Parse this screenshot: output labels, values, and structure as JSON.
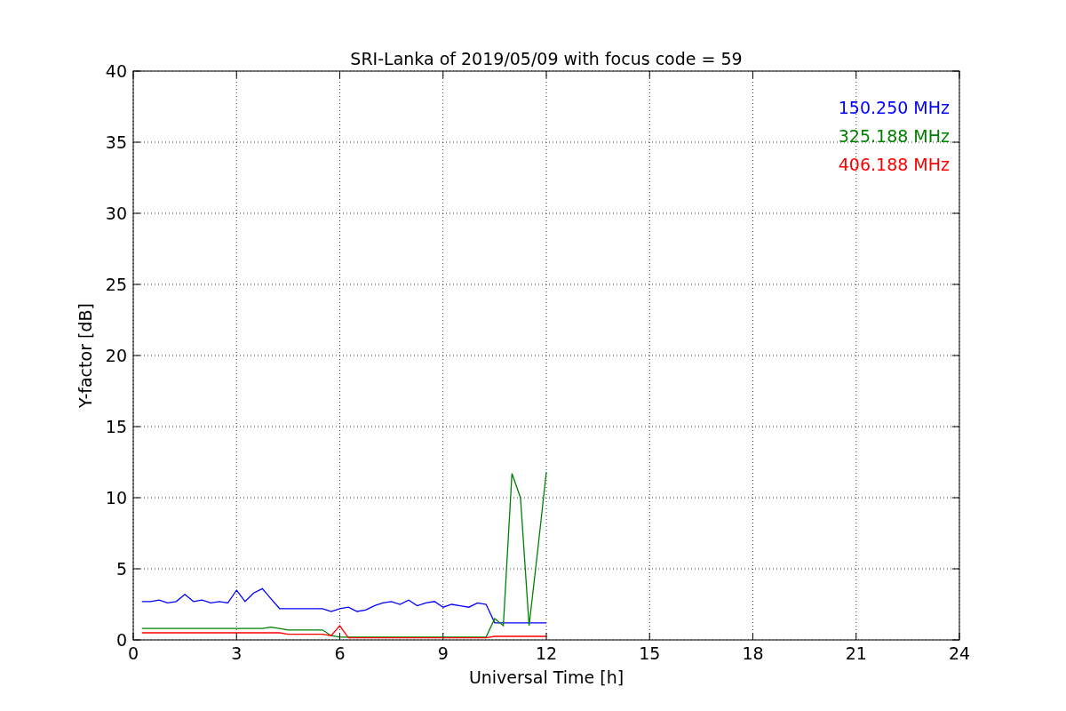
{
  "chart_data": {
    "type": "line",
    "title": "SRI-Lanka of 2019/05/09 with focus code = 59",
    "xlabel": "Universal Time [h]",
    "ylabel": "Y-factor [dB]",
    "xlim": [
      0,
      24
    ],
    "ylim": [
      0,
      40
    ],
    "grid": true,
    "xticks": [
      0,
      3,
      6,
      9,
      12,
      15,
      18,
      21,
      24
    ],
    "yticks": [
      0,
      5,
      10,
      15,
      20,
      25,
      30,
      35,
      40
    ],
    "x": [
      0.25,
      0.5,
      0.75,
      1,
      1.25,
      1.5,
      1.75,
      2,
      2.25,
      2.5,
      2.75,
      3,
      3.25,
      3.5,
      3.75,
      4,
      4.25,
      4.5,
      4.75,
      5,
      5.25,
      5.5,
      5.75,
      6,
      6.25,
      6.5,
      6.75,
      7,
      7.25,
      7.5,
      7.75,
      8,
      8.25,
      8.5,
      8.75,
      9,
      9.25,
      9.5,
      9.75,
      10,
      10.25,
      10.5,
      10.75,
      11,
      11.25,
      11.5,
      11.75,
      12
    ],
    "series": [
      {
        "name": "150.250 MHz",
        "color": "#0000ff",
        "values": [
          2.7,
          2.7,
          2.8,
          2.6,
          2.7,
          3.2,
          2.7,
          2.8,
          2.6,
          2.7,
          2.6,
          3.5,
          2.7,
          3.3,
          3.6,
          2.9,
          2.2,
          2.2,
          2.2,
          2.2,
          2.2,
          2.2,
          2.0,
          2.2,
          2.3,
          2.0,
          2.1,
          2.4,
          2.6,
          2.7,
          2.5,
          2.8,
          2.4,
          2.6,
          2.7,
          2.3,
          2.5,
          2.4,
          2.3,
          2.6,
          2.5,
          1.2,
          1.2,
          1.2,
          1.2,
          1.2,
          1.2,
          1.2
        ]
      },
      {
        "name": "325.188 MHz",
        "color": "#008000",
        "values": [
          0.8,
          0.8,
          0.8,
          0.8,
          0.8,
          0.8,
          0.8,
          0.8,
          0.8,
          0.8,
          0.8,
          0.8,
          0.8,
          0.8,
          0.8,
          0.9,
          0.8,
          0.7,
          0.7,
          0.7,
          0.7,
          0.7,
          0.3,
          0.2,
          0.2,
          0.2,
          0.2,
          0.2,
          0.2,
          0.2,
          0.2,
          0.2,
          0.2,
          0.2,
          0.2,
          0.2,
          0.2,
          0.2,
          0.2,
          0.2,
          0.2,
          1.5,
          1.0,
          11.7,
          10.0,
          1.0,
          6.3,
          11.8
        ]
      },
      {
        "name": "406.188 MHz",
        "color": "#ff0000",
        "values": [
          0.5,
          0.5,
          0.5,
          0.5,
          0.5,
          0.5,
          0.5,
          0.5,
          0.5,
          0.5,
          0.5,
          0.5,
          0.5,
          0.5,
          0.5,
          0.5,
          0.5,
          0.4,
          0.4,
          0.4,
          0.4,
          0.4,
          0.3,
          1.0,
          0.15,
          0.15,
          0.15,
          0.15,
          0.15,
          0.15,
          0.15,
          0.15,
          0.15,
          0.15,
          0.15,
          0.15,
          0.15,
          0.15,
          0.15,
          0.15,
          0.15,
          0.25,
          0.25,
          0.25,
          0.25,
          0.25,
          0.25,
          0.25
        ]
      }
    ]
  }
}
